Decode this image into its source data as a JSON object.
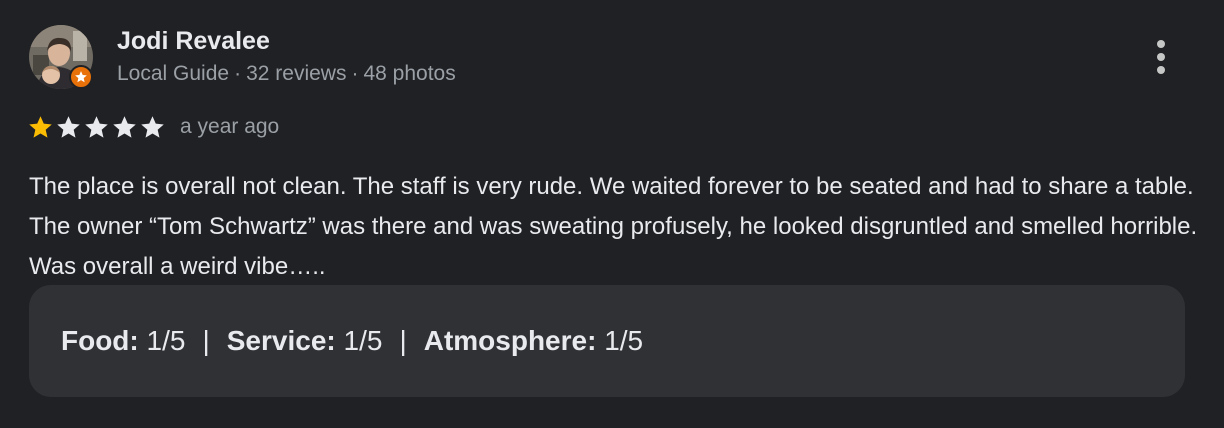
{
  "author": {
    "name": "Jodi Revalee",
    "meta": [
      "Local Guide",
      "32 reviews",
      "48 photos"
    ],
    "meta_separator": "·",
    "avatar_icon": "user-photo",
    "badge_icon": "star-icon",
    "badge_color": "#e8710a"
  },
  "more_menu_icon": "more-vert-icon",
  "review": {
    "rating": 1,
    "max_rating": 5,
    "star_filled_color": "#fbbc04",
    "star_empty_color": "#e8eaed",
    "date": "a year ago",
    "text": "The place is overall not clean. The staff is very rude. We waited forever to be seated and had to share a table. The owner “Tom Schwartz” was there and was sweating profusely, he looked disgruntled and smelled horrible. Was overall a weird vibe….."
  },
  "ratings": {
    "separator": "|",
    "items": [
      {
        "label": "Food:",
        "value": "1/5"
      },
      {
        "label": "Service:",
        "value": "1/5"
      },
      {
        "label": "Atmosphere:",
        "value": "1/5"
      }
    ]
  }
}
